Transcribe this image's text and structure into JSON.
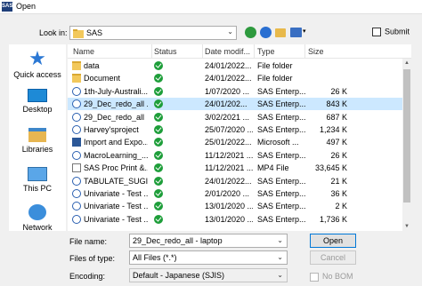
{
  "window": {
    "title": "Open",
    "app_badge": "SAS"
  },
  "lookin": {
    "label": "Look in:",
    "value": "SAS"
  },
  "submit": {
    "label": "Submit",
    "checked": false
  },
  "places": [
    {
      "label": "Quick access",
      "icon": "star-icon"
    },
    {
      "label": "Desktop",
      "icon": "desktop-icon"
    },
    {
      "label": "Libraries",
      "icon": "libraries-icon"
    },
    {
      "label": "This PC",
      "icon": "computer-icon"
    },
    {
      "label": "Network",
      "icon": "network-icon"
    }
  ],
  "columns": {
    "name": "Name",
    "status": "Status",
    "date": "Date modif...",
    "type": "Type",
    "size": "Size"
  },
  "files": [
    {
      "name": "data",
      "date": "24/01/2022...",
      "type": "File folder",
      "size": "",
      "icon": "folder-icon"
    },
    {
      "name": "Document",
      "date": "24/01/2022...",
      "type": "File folder",
      "size": "",
      "icon": "folder-icon"
    },
    {
      "name": "1th-July-Australi...",
      "date": "1/07/2020 ...",
      "type": "SAS Enterp...",
      "size": "26 K",
      "icon": "sas-file-icon"
    },
    {
      "name": "29_Dec_redo_all ...",
      "date": "24/01/202...",
      "type": "SAS Enterp...",
      "size": "843 K",
      "icon": "sas-file-icon",
      "selected": true
    },
    {
      "name": "29_Dec_redo_all",
      "date": "3/02/2021 ...",
      "type": "SAS Enterp...",
      "size": "687 K",
      "icon": "sas-file-icon"
    },
    {
      "name": "Harvey'sproject",
      "date": "25/07/2020 ...",
      "type": "SAS Enterp...",
      "size": "1,234 K",
      "icon": "sas-file-icon"
    },
    {
      "name": "Import and Expo...",
      "date": "25/01/2022...",
      "type": "Microsoft ...",
      "size": "497 K",
      "icon": "word-file-icon"
    },
    {
      "name": "MacroLearning_...",
      "date": "11/12/2021 ...",
      "type": "SAS Enterp...",
      "size": "26 K",
      "icon": "sas-file-icon"
    },
    {
      "name": "SAS Proc Print &...",
      "date": "11/12/2021 ...",
      "type": "MP4 File",
      "size": "33,645 K",
      "icon": "video-file-icon"
    },
    {
      "name": "TABULATE_SUGI2...",
      "date": "24/01/2022...",
      "type": "SAS Enterp...",
      "size": "21 K",
      "icon": "sas-file-icon"
    },
    {
      "name": "Univariate - Test ...",
      "date": "2/01/2020 ...",
      "type": "SAS Enterp...",
      "size": "36 K",
      "icon": "sas-file-icon"
    },
    {
      "name": "Univariate - Test ...",
      "date": "13/01/2020 ...",
      "type": "SAS Enterp...",
      "size": "2 K",
      "icon": "sas-file-icon"
    },
    {
      "name": "Univariate - Test ...",
      "date": "13/01/2020 ...",
      "type": "SAS Enterp...",
      "size": "1,736 K",
      "icon": "sas-file-icon"
    }
  ],
  "filename": {
    "label": "File name:",
    "value": "29_Dec_redo_all - laptop"
  },
  "filetype": {
    "label": "Files of type:",
    "value": "All Files (*.*)"
  },
  "encoding": {
    "label": "Encoding:",
    "value": "Default - Japanese (SJIS)"
  },
  "buttons": {
    "open": "Open",
    "cancel": "Cancel"
  },
  "nobom": {
    "label": "No BOM",
    "checked": false,
    "enabled": false
  }
}
